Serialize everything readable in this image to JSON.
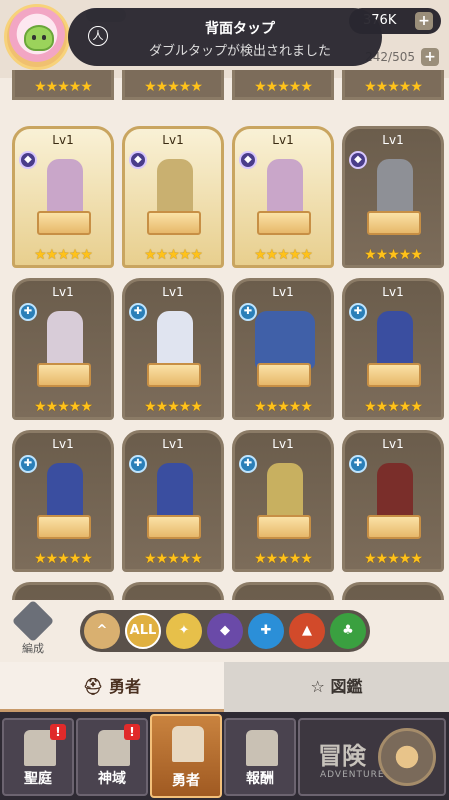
{
  "topbar": {
    "currency": "376K",
    "capacity": "242/505",
    "plus": "+"
  },
  "toast": {
    "title": "背面タップ",
    "message": "ダブルタップが検出されました",
    "icon": "accessibility-icon"
  },
  "cards": {
    "level": "Lv1",
    "stars": "★★★★★"
  },
  "filter": {
    "formation_label": "編成",
    "buttons": [
      "^",
      "ALL",
      "light",
      "dark",
      "water",
      "fire",
      "wind"
    ],
    "colors": [
      "#d9b070",
      "#e0b040",
      "#e7c04a",
      "#6a4aa8",
      "#2b8fd8",
      "#d24a2a",
      "#3aa040"
    ]
  },
  "tabs": {
    "hero": "勇者",
    "dex": "図鑑"
  },
  "nav": {
    "items": [
      {
        "label": "聖庭",
        "badge": "!"
      },
      {
        "label": "神域",
        "badge": "!"
      },
      {
        "label": "勇者",
        "badge": ""
      },
      {
        "label": "報酬",
        "badge": ""
      }
    ],
    "adventure_big": "冒険",
    "adventure_small": "ADVENTURE"
  }
}
